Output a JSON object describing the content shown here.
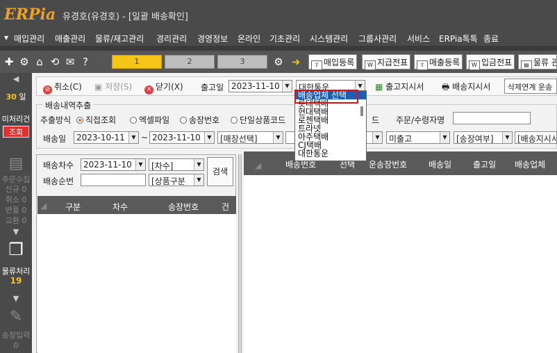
{
  "app": {
    "logo": "ERPia",
    "window_title": "유경호(유경호) - [일괄 배송확인]"
  },
  "menu": [
    "매입관리",
    "매출관리",
    "물류/재고관리",
    "경리관리",
    "경영정보",
    "온라인",
    "기초관리",
    "시스템관리",
    "그룹사관리",
    "서비스",
    "ERPia톡톡",
    "종료"
  ],
  "toolbar": {
    "tabs": [
      "1",
      "2",
      "3"
    ],
    "buttons": [
      "매입등록",
      "지급전표",
      "매출등록",
      "입금전표",
      "물류 관"
    ]
  },
  "sidebar": {
    "days_value": "30",
    "days_unit": "일",
    "unprocessed": "미처리건",
    "lookup": "조회",
    "order_items": [
      "주문수집",
      "신규 0",
      "취소 0",
      "반품 0",
      "교환 0"
    ],
    "logistics_label": "물류처리",
    "logistics_count": "19",
    "invoice_label": "송장입력",
    "invoice_count": "0"
  },
  "actions": {
    "cancel": "취소(C)",
    "save": "저장(S)",
    "close": "닫기(X)",
    "ship_date_label": "출고일",
    "ship_date": "2023-11-10",
    "courier_select": "대한통운",
    "ship_instruction": "출고지시서",
    "delivery_instruction": "배송지시서",
    "delete_link": "삭제연계 운송"
  },
  "extract": {
    "section_title": "배송내역추출",
    "method_label": "추출방식",
    "methods": [
      "직접조회",
      "엑셀파일",
      "송장번호",
      "단일상품코드"
    ],
    "code_suffix": "드",
    "orderer_label": "주문/수령자명",
    "date_label": "배송일",
    "date_from": "2023-10-11",
    "tilde": "~",
    "date_to": "2023-11-10",
    "store_select": "[매장선택]",
    "unshipped_select": "미출고",
    "invoice_status_select": "[송장여부]",
    "instruction_select": "[배송지시서"
  },
  "left_panel": {
    "batch_label": "배송차수",
    "batch_date": "2023-11-10",
    "batch_select": "[차수]",
    "order_label": "배송순번",
    "product_select": "[상품구분",
    "search_button": "검색",
    "columns": [
      "구분",
      "차수",
      "송장번호",
      "건수"
    ]
  },
  "right_grid": {
    "columns": [
      "배송번호",
      "선택",
      "운송장번호",
      "배송일",
      "출고일",
      "배송업체"
    ]
  },
  "dropdown": {
    "options": [
      "배송업체 선택",
      "롯데택배",
      "현대택배",
      "로젠택배",
      "트라넷",
      "아주택배",
      "CJ택배",
      "대한통운"
    ],
    "selected_index": 0
  }
}
